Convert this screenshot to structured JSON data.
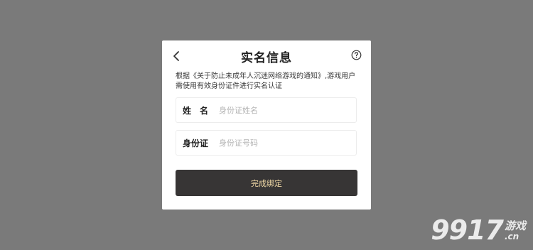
{
  "dialog": {
    "title": "实名信息",
    "notice": "根据《关于防止未成年人沉迷网络游戏的通知》,游戏用户需使用有效身份证件进行实名认证",
    "back_icon": "chevron-left-icon",
    "help_icon": "question-circle-icon"
  },
  "form": {
    "name_label": "姓　名",
    "name_placeholder": "身份证姓名",
    "name_value": "",
    "id_label": "身份证",
    "id_placeholder": "身份证号码",
    "id_value": "",
    "submit_label": "完成绑定"
  },
  "watermark": {
    "number": "9917",
    "chinese": "游戏",
    "domain": ".cn"
  },
  "colors": {
    "backdrop": "#7a7a7a",
    "button_bg": "#373535",
    "button_text": "#f0d9a6"
  }
}
